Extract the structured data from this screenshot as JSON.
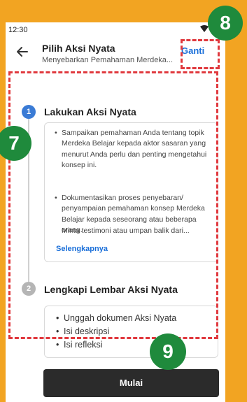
{
  "status_bar": {
    "time": "12:30",
    "icons": [
      "wifi-icon",
      "signal-icon"
    ]
  },
  "app_bar": {
    "back_icon": "arrow-left-icon",
    "title": "Pilih Aksi Nyata",
    "subtitle": "Menyebarkan Pemahaman Merdeka...",
    "action_label": "Ganti"
  },
  "steps": [
    {
      "number": "1",
      "title": "Lakukan Aksi Nyata",
      "bullets": [
        "Sampaikan pemahaman Anda tentang topik Merdeka Belajar kepada aktor sasaran yang menurut Anda perlu dan penting mengetahui konsep ini.",
        "Dokumentasikan proses penyebaran/ penyampaian pemahaman konsep Merdeka Belajar kepada seseorang atau beberapa orang.",
        "Minta testimoni atau umpan balik dari..."
      ],
      "link": "Selengkapnya"
    },
    {
      "number": "2",
      "title": "Lengkapi Lembar Aksi Nyata",
      "bullets": [
        "Unggah dokumen Aksi Nyata",
        "Isi deskripsi",
        "Isi refleksi"
      ]
    }
  ],
  "primary_button": "Mulai",
  "annotation_badges": [
    "7",
    "8",
    "9"
  ],
  "colors": {
    "background": "#F2A422",
    "highlight_dash": "#E0393E",
    "badge": "#1f8a3c",
    "link": "#1a6fd9",
    "step_active": "#3a7bd5",
    "button": "#2b2b2b"
  }
}
